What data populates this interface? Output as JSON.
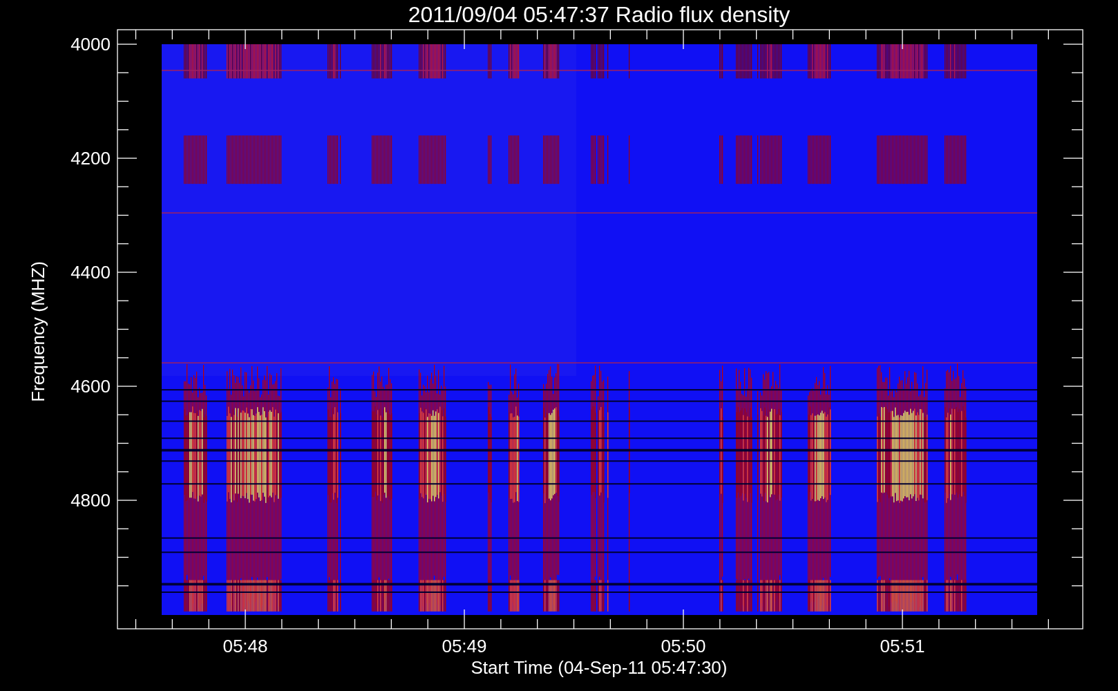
{
  "title": "2011/09/04 05:47:37 Radio flux density",
  "y_axis": {
    "label": "Frequency (MHZ)",
    "ticks": [
      "4000",
      "4200",
      "4400",
      "4600",
      "4800"
    ]
  },
  "x_axis": {
    "label": "Start Time (04-Sep-11 05:47:30)",
    "ticks": [
      "05:48",
      "05:49",
      "05:50",
      "05:51"
    ]
  }
}
